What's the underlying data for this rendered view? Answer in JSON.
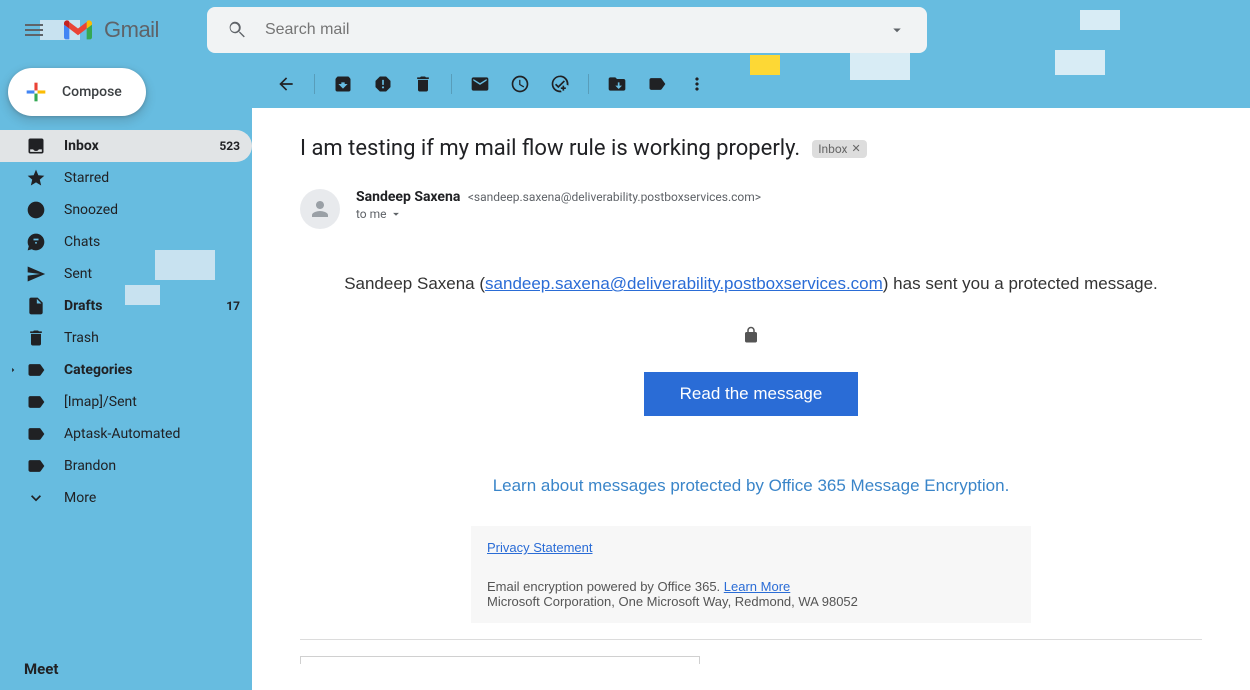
{
  "app_name": "Gmail",
  "search": {
    "placeholder": "Search mail"
  },
  "compose_label": "Compose",
  "sidebar": {
    "items": [
      {
        "label": "Inbox",
        "count": "523",
        "selected": true,
        "bold": true
      },
      {
        "label": "Starred"
      },
      {
        "label": "Snoozed"
      },
      {
        "label": "Chats"
      },
      {
        "label": "Sent"
      },
      {
        "label": "Drafts",
        "count": "17",
        "bold": true
      },
      {
        "label": "Trash"
      },
      {
        "label": "Categories",
        "bold": true
      },
      {
        "label": "[Imap]/Sent"
      },
      {
        "label": "Aptask-Automated"
      },
      {
        "label": "Brandon"
      },
      {
        "label": "More"
      }
    ]
  },
  "meet_label": "Meet",
  "message": {
    "subject": "I am testing if my mail flow rule is working properly.",
    "chip_label": "Inbox",
    "sender_name": "Sandeep Saxena",
    "sender_email": "<sandeep.saxena@deliverability.postboxservices.com>",
    "to_line": "to me",
    "body_prefix": "Sandeep Saxena (",
    "body_link": "sandeep.saxena@deliverability.postboxservices.com",
    "body_suffix": ") has sent you a protected message.",
    "read_button": "Read the message",
    "learn_line": "Learn about messages protected by Office 365 Message Encryption.",
    "privacy": "Privacy Statement",
    "enc_powered": "Email encryption powered by Office 365. ",
    "learn_more": "Learn More",
    "ms_addr": "Microsoft Corporation, One Microsoft Way, Redmond, WA 98052"
  }
}
